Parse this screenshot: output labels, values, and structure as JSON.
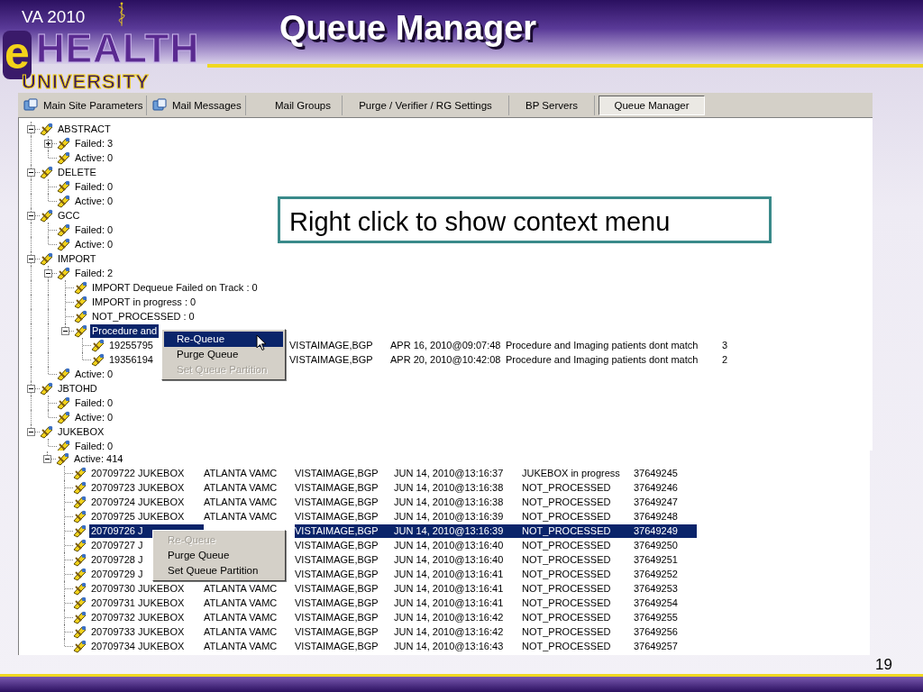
{
  "logo": {
    "top_line": "VA 2010",
    "prefix": "e",
    "word": "HEALTH",
    "subtitle": "UNIVERSITY"
  },
  "slide_title": "Queue Manager",
  "tabs": [
    {
      "label": "Main Site Parameters",
      "icon": true,
      "selected": false
    },
    {
      "label": "Mail Messages",
      "icon": true,
      "selected": false
    },
    {
      "label": "Mail Groups",
      "icon": false,
      "selected": false
    },
    {
      "label": "Purge / Verifier / RG Settings",
      "icon": false,
      "selected": false
    },
    {
      "label": "BP Servers",
      "icon": false,
      "selected": false
    },
    {
      "label": "Queue Manager",
      "icon": false,
      "selected": true
    }
  ],
  "tree": [
    {
      "label": "ABSTRACT",
      "expanded": true,
      "selected": false,
      "children": [
        {
          "label": "Failed: 3",
          "expanded": false,
          "selected": false
        },
        {
          "label": "Active: 0",
          "selected": false
        }
      ]
    },
    {
      "label": "DELETE",
      "expanded": true,
      "selected": false,
      "children": [
        {
          "label": "Failed: 0",
          "selected": false
        },
        {
          "label": "Active: 0",
          "selected": false
        }
      ]
    },
    {
      "label": "GCC",
      "expanded": true,
      "selected": false,
      "children": [
        {
          "label": "Failed: 0",
          "selected": false
        },
        {
          "label": "Active: 0",
          "selected": false
        }
      ]
    },
    {
      "label": "IMPORT",
      "expanded": true,
      "selected": false,
      "children": [
        {
          "label": "Failed: 2",
          "expanded": true,
          "selected": false,
          "children": [
            {
              "label": "IMPORT Dequeue Failed on Track : 0",
              "selected": false
            },
            {
              "label": "IMPORT in progress : 0",
              "selected": false
            },
            {
              "label": "NOT_PROCESSED : 0",
              "selected": false
            },
            {
              "label": "Procedure and",
              "expanded": true,
              "selected": true,
              "children": [
                {
                  "label": "19255795",
                  "selected": false,
                  "user": "VISTAIMAGE,BGP",
                  "date": "APR 16, 2010@09:07:48",
                  "reason": "Procedure and Imaging patients dont match",
                  "count": "3"
                },
                {
                  "label": "19356194",
                  "selected": false,
                  "user": "VISTAIMAGE,BGP",
                  "date": "APR 20, 2010@10:42:08",
                  "reason": "Procedure and Imaging patients dont match",
                  "count": "2"
                }
              ]
            }
          ]
        },
        {
          "label": "Active: 0",
          "selected": false
        }
      ]
    },
    {
      "label": "JBTOHD",
      "expanded": true,
      "selected": false,
      "children": [
        {
          "label": "Failed: 0",
          "selected": false
        },
        {
          "label": "Active: 0",
          "selected": false
        }
      ]
    },
    {
      "label": "JUKEBOX",
      "expanded": true,
      "selected": false,
      "children": [
        {
          "label": "Failed: 0",
          "selected": false
        }
      ]
    }
  ],
  "menu_1": {
    "cursor": true,
    "items": [
      {
        "label": "Re-Queue",
        "selected": true,
        "disabled": false
      },
      {
        "label": "Purge Queue",
        "selected": false,
        "disabled": false
      },
      {
        "label": "Set Queue Partition",
        "selected": false,
        "disabled": true
      }
    ]
  },
  "callout": {
    "text": "Right click to show context menu"
  },
  "jukebox_panel": {
    "nodes": [
      {
        "label": "Active: 414",
        "expanded": true,
        "selected": false,
        "children": [
          {
            "label": "20709722 JUKEBOX",
            "selected": false,
            "site": "ATLANTA VAMC",
            "user": "VISTAIMAGE,BGP",
            "date": "JUN 14, 2010@13:16:37",
            "status": "JUKEBOX in progress",
            "number": "37649245"
          },
          {
            "label": "20709723 JUKEBOX",
            "selected": false,
            "site": "ATLANTA VAMC",
            "user": "VISTAIMAGE,BGP",
            "date": "JUN 14, 2010@13:16:38",
            "status": "NOT_PROCESSED",
            "number": "37649246"
          },
          {
            "label": "20709724 JUKEBOX",
            "selected": false,
            "site": "ATLANTA VAMC",
            "user": "VISTAIMAGE,BGP",
            "date": "JUN 14, 2010@13:16:38",
            "status": "NOT_PROCESSED",
            "number": "37649247"
          },
          {
            "label": "20709725 JUKEBOX",
            "selected": false,
            "site": "ATLANTA VAMC",
            "user": "VISTAIMAGE,BGP",
            "date": "JUN 14, 2010@13:16:39",
            "status": "NOT_PROCESSED",
            "number": "37649248"
          },
          {
            "label": "20709726 J",
            "selected": true,
            "user": "VISTAIMAGE,BGP",
            "date": "JUN 14, 2010@13:16:39",
            "status": "NOT_PROCESSED",
            "number": "37649249"
          },
          {
            "label": "20709727 J",
            "selected": false,
            "user": "VISTAIMAGE,BGP",
            "date": "JUN 14, 2010@13:16:40",
            "status": "NOT_PROCESSED",
            "number": "37649250"
          },
          {
            "label": "20709728 J",
            "selected": false,
            "user": "VISTAIMAGE,BGP",
            "date": "JUN 14, 2010@13:16:40",
            "status": "NOT_PROCESSED",
            "number": "37649251"
          },
          {
            "label": "20709729 J",
            "selected": false,
            "user": "VISTAIMAGE,BGP",
            "date": "JUN 14, 2010@13:16:41",
            "status": "NOT_PROCESSED",
            "number": "37649252"
          },
          {
            "label": "20709730 JUKEBOX",
            "selected": false,
            "site": "ATLANTA VAMC",
            "user": "VISTAIMAGE,BGP",
            "date": "JUN 14, 2010@13:16:41",
            "status": "NOT_PROCESSED",
            "number": "37649253"
          },
          {
            "label": "20709731 JUKEBOX",
            "selected": false,
            "site": "ATLANTA VAMC",
            "user": "VISTAIMAGE,BGP",
            "date": "JUN 14, 2010@13:16:41",
            "status": "NOT_PROCESSED",
            "number": "37649254"
          },
          {
            "label": "20709732 JUKEBOX",
            "selected": false,
            "site": "ATLANTA VAMC",
            "user": "VISTAIMAGE,BGP",
            "date": "JUN 14, 2010@13:16:42",
            "status": "NOT_PROCESSED",
            "number": "37649255"
          },
          {
            "label": "20709733 JUKEBOX",
            "selected": false,
            "site": "ATLANTA VAMC",
            "user": "VISTAIMAGE,BGP",
            "date": "JUN 14, 2010@13:16:42",
            "status": "NOT_PROCESSED",
            "number": "37649256"
          },
          {
            "label": "20709734 JUKEBOX",
            "selected": false,
            "site": "ATLANTA VAMC",
            "user": "VISTAIMAGE,BGP",
            "date": "JUN 14, 2010@13:16:43",
            "status": "NOT_PROCESSED",
            "number": "37649257"
          }
        ]
      }
    ]
  },
  "menu_2": {
    "cursor": false,
    "items": [
      {
        "label": "Re-Queue",
        "selected": false,
        "disabled": true
      },
      {
        "label": "Purge Queue",
        "selected": false,
        "disabled": false
      },
      {
        "label": "Set Queue Partition",
        "selected": false,
        "disabled": false
      }
    ]
  },
  "page_number": "19"
}
